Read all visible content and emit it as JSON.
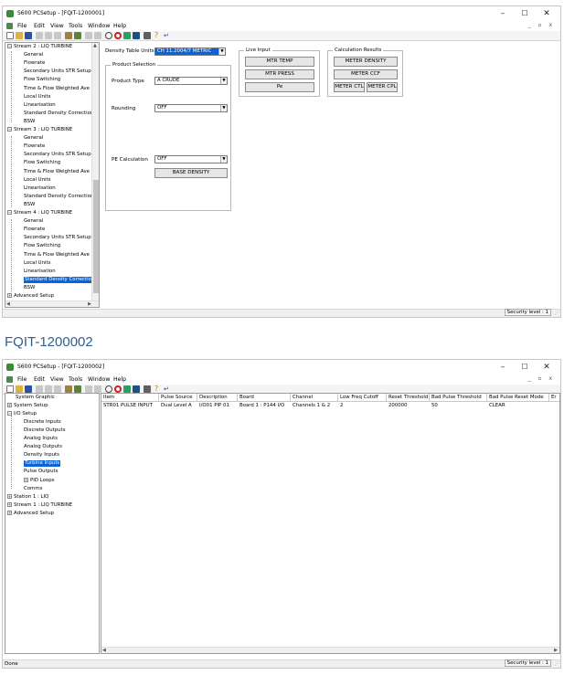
{
  "window1": {
    "title": "S600 PCSetup - [FQIT-1200001]",
    "menus": [
      "File",
      "Edit",
      "View",
      "Tools",
      "Window",
      "Help"
    ],
    "tree": [
      {
        "label": "Stream 2 : LIQ TURBINE",
        "level": 0,
        "expander": "−"
      },
      {
        "label": "General",
        "level": 1
      },
      {
        "label": "Flowrate",
        "level": 1
      },
      {
        "label": "Secondary Units STR Setup",
        "level": 1
      },
      {
        "label": "Flow Switching",
        "level": 1
      },
      {
        "label": "Time & Flow Weighted Ave",
        "level": 1
      },
      {
        "label": "Local Units",
        "level": 1
      },
      {
        "label": "Linearisation",
        "level": 1
      },
      {
        "label": "Standard Density Correction",
        "level": 1
      },
      {
        "label": "BSW",
        "level": 1
      },
      {
        "label": "Stream 3 : LIQ TURBINE",
        "level": 0,
        "expander": "−"
      },
      {
        "label": "General",
        "level": 1
      },
      {
        "label": "Flowrate",
        "level": 1
      },
      {
        "label": "Secondary Units STR Setup",
        "level": 1
      },
      {
        "label": "Flow Switching",
        "level": 1
      },
      {
        "label": "Time & Flow Weighted Ave",
        "level": 1
      },
      {
        "label": "Local Units",
        "level": 1
      },
      {
        "label": "Linearisation",
        "level": 1
      },
      {
        "label": "Standard Density Correction",
        "level": 1
      },
      {
        "label": "BSW",
        "level": 1
      },
      {
        "label": "Stream 4 : LIQ TURBINE",
        "level": 0,
        "expander": "−"
      },
      {
        "label": "General",
        "level": 1
      },
      {
        "label": "Flowrate",
        "level": 1
      },
      {
        "label": "Secondary Units STR Setup",
        "level": 1
      },
      {
        "label": "Flow Switching",
        "level": 1
      },
      {
        "label": "Time & Flow Weighted Ave",
        "level": 1
      },
      {
        "label": "Local Units",
        "level": 1
      },
      {
        "label": "Linearisation",
        "level": 1
      },
      {
        "label": "Standard Density Correction",
        "level": 1,
        "selected": true
      },
      {
        "label": "BSW",
        "level": 1
      },
      {
        "label": "Advanced Setup",
        "level": 0,
        "expander": "+"
      }
    ],
    "form": {
      "density_table_label": "Density Table Units",
      "density_table_value": "CH 11.2004/7 METRIC",
      "product_selection_title": "Product Selection",
      "product_type_label": "Product Type",
      "product_type_value": "A CRUDE",
      "rounding_label": "Rounding",
      "rounding_value": "OFF",
      "pe_calc_label": "PE Calculation",
      "pe_calc_value": "OFF",
      "base_density_button": "BASE DENSITY",
      "live_input_title": "Live Input",
      "mtr_temp_button": "MTR TEMP",
      "mtr_press_button": "MTR PRESS",
      "pe_button": "Pe",
      "calc_results_title": "Calculation Results",
      "meter_density_button": "METER DENSITY",
      "meter_ccf_button": "METER CCF",
      "meter_ctl_button": "METER CTL",
      "meter_cpl_button": "METER CPL"
    },
    "status": {
      "security": "Security level : 1"
    }
  },
  "heading": "FQIT-1200002",
  "window2": {
    "title": "S600 PCSetup - [FQIT-1200002]",
    "menus": [
      "File",
      "Edit",
      "View",
      "Tools",
      "Window",
      "Help"
    ],
    "tree": [
      {
        "label": "System Graphic",
        "level": 0
      },
      {
        "label": "System Setup",
        "level": 0,
        "expander": "+"
      },
      {
        "label": "I/O Setup",
        "level": 0,
        "expander": "−"
      },
      {
        "label": "Discrete Inputs",
        "level": 1
      },
      {
        "label": "Discrete Outputs",
        "level": 1
      },
      {
        "label": "Analog Inputs",
        "level": 1
      },
      {
        "label": "Analog Outputs",
        "level": 1
      },
      {
        "label": "Density Inputs",
        "level": 1
      },
      {
        "label": "Turbine Inputs",
        "level": 1,
        "selected": true
      },
      {
        "label": "Pulse Outputs",
        "level": 1
      },
      {
        "label": "PID Loops",
        "level": 1,
        "expander": "+"
      },
      {
        "label": "Comms",
        "level": 1
      },
      {
        "label": "Station 1 : LIQ",
        "level": 0,
        "expander": "+"
      },
      {
        "label": "Stream 1 : LIQ TURBINE",
        "level": 0,
        "expander": "+"
      },
      {
        "label": "Advanced Setup",
        "level": 0,
        "expander": "+"
      }
    ],
    "grid": {
      "headers": [
        "Item",
        "Pulse Source",
        "Description",
        "Board",
        "Channel",
        "Low Freq Cutoff",
        "Reset Threshold",
        "Bad Pulse Threshold",
        "Bad Pulse Reset Mode",
        "Er"
      ],
      "rows": [
        [
          "STR01 PULSE INPUT",
          "Dual Level A",
          "I/O01 PIP 01",
          "Board 1 : P144 I/O",
          "Channels 1 & 2",
          "2",
          "200000",
          "50",
          "CLEAR",
          ""
        ]
      ]
    },
    "status": {
      "left": "Done",
      "security": "Security level : 1"
    }
  }
}
